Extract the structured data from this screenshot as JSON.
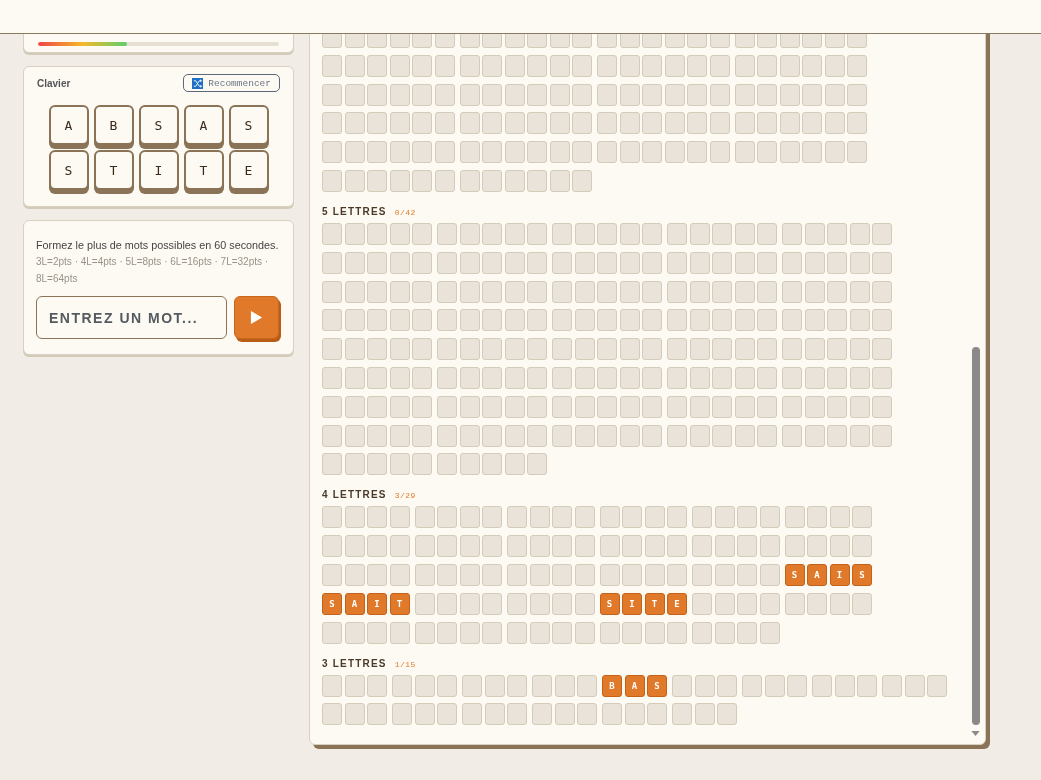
{
  "progress": {
    "level": 0.37
  },
  "keyboard": {
    "title": "Clavier",
    "restart_button": "Recommencer",
    "keys": [
      "A",
      "B",
      "S",
      "A",
      "S",
      "S",
      "T",
      "I",
      "T",
      "E"
    ]
  },
  "instructions": {
    "text": "Formez le plus de mots possibles en 60 secondes.",
    "scoring": "3L=2pts · 4L=4pts · 5L=8pts · 6L=16pts · 7L=32pts · 8L=64pts"
  },
  "word_input": {
    "placeholder": "ENTREZ UN MOT..."
  },
  "sections": [
    {
      "kind": "six",
      "words": [
        {
          "found": false
        },
        {
          "found": false
        },
        {
          "found": false
        },
        {
          "found": false
        },
        {
          "found": false
        },
        {
          "found": false
        },
        {
          "found": false
        },
        {
          "found": false
        },
        {
          "found": false
        },
        {
          "found": false
        },
        {
          "found": false
        },
        {
          "found": false
        },
        {
          "found": false
        },
        {
          "found": false
        },
        {
          "found": false
        },
        {
          "found": false
        },
        {
          "found": false
        },
        {
          "found": false
        },
        {
          "found": false
        },
        {
          "found": false
        },
        {
          "found": false
        },
        {
          "found": false
        }
      ]
    },
    {
      "title": "5 LETTRES",
      "count": "0/42",
      "kind": "five",
      "words": [
        {
          "found": false
        },
        {
          "found": false
        },
        {
          "found": false
        },
        {
          "found": false
        },
        {
          "found": false
        },
        {
          "found": false
        },
        {
          "found": false
        },
        {
          "found": false
        },
        {
          "found": false
        },
        {
          "found": false
        },
        {
          "found": false
        },
        {
          "found": false
        },
        {
          "found": false
        },
        {
          "found": false
        },
        {
          "found": false
        },
        {
          "found": false
        },
        {
          "found": false
        },
        {
          "found": false
        },
        {
          "found": false
        },
        {
          "found": false
        },
        {
          "found": false
        },
        {
          "found": false
        },
        {
          "found": false
        },
        {
          "found": false
        },
        {
          "found": false
        },
        {
          "found": false
        },
        {
          "found": false
        },
        {
          "found": false
        },
        {
          "found": false
        },
        {
          "found": false
        },
        {
          "found": false
        },
        {
          "found": false
        },
        {
          "found": false
        },
        {
          "found": false
        },
        {
          "found": false
        },
        {
          "found": false
        },
        {
          "found": false
        },
        {
          "found": false
        },
        {
          "found": false
        },
        {
          "found": false
        },
        {
          "found": false
        },
        {
          "found": false
        }
      ]
    },
    {
      "title": "4 LETTRES",
      "count": "3/29",
      "kind": "four",
      "words": [
        {
          "found": false
        },
        {
          "found": false
        },
        {
          "found": false
        },
        {
          "found": false
        },
        {
          "found": false
        },
        {
          "found": false
        },
        {
          "found": false
        },
        {
          "found": false
        },
        {
          "found": false
        },
        {
          "found": false
        },
        {
          "found": false
        },
        {
          "found": false
        },
        {
          "found": false
        },
        {
          "found": false
        },
        {
          "found": false
        },
        {
          "found": false
        },
        {
          "found": false
        },
        {
          "found": true,
          "letters": [
            "S",
            "A",
            "I",
            "S"
          ]
        },
        {
          "found": true,
          "letters": [
            "S",
            "A",
            "I",
            "T"
          ]
        },
        {
          "found": false
        },
        {
          "found": false
        },
        {
          "found": true,
          "letters": [
            "S",
            "I",
            "T",
            "E"
          ]
        },
        {
          "found": false
        },
        {
          "found": false
        },
        {
          "found": false
        },
        {
          "found": false
        },
        {
          "found": false
        },
        {
          "found": false
        },
        {
          "found": false
        }
      ]
    },
    {
      "title": "3 LETTRES",
      "count": "1/15",
      "kind": "three",
      "words": [
        {
          "found": false
        },
        {
          "found": false
        },
        {
          "found": false
        },
        {
          "found": false
        },
        {
          "found": true,
          "letters": [
            "B",
            "A",
            "S"
          ]
        },
        {
          "found": false
        },
        {
          "found": false
        },
        {
          "found": false
        },
        {
          "found": false
        },
        {
          "found": false
        },
        {
          "found": false
        },
        {
          "found": false
        },
        {
          "found": false
        },
        {
          "found": false
        },
        {
          "found": false
        }
      ]
    }
  ]
}
